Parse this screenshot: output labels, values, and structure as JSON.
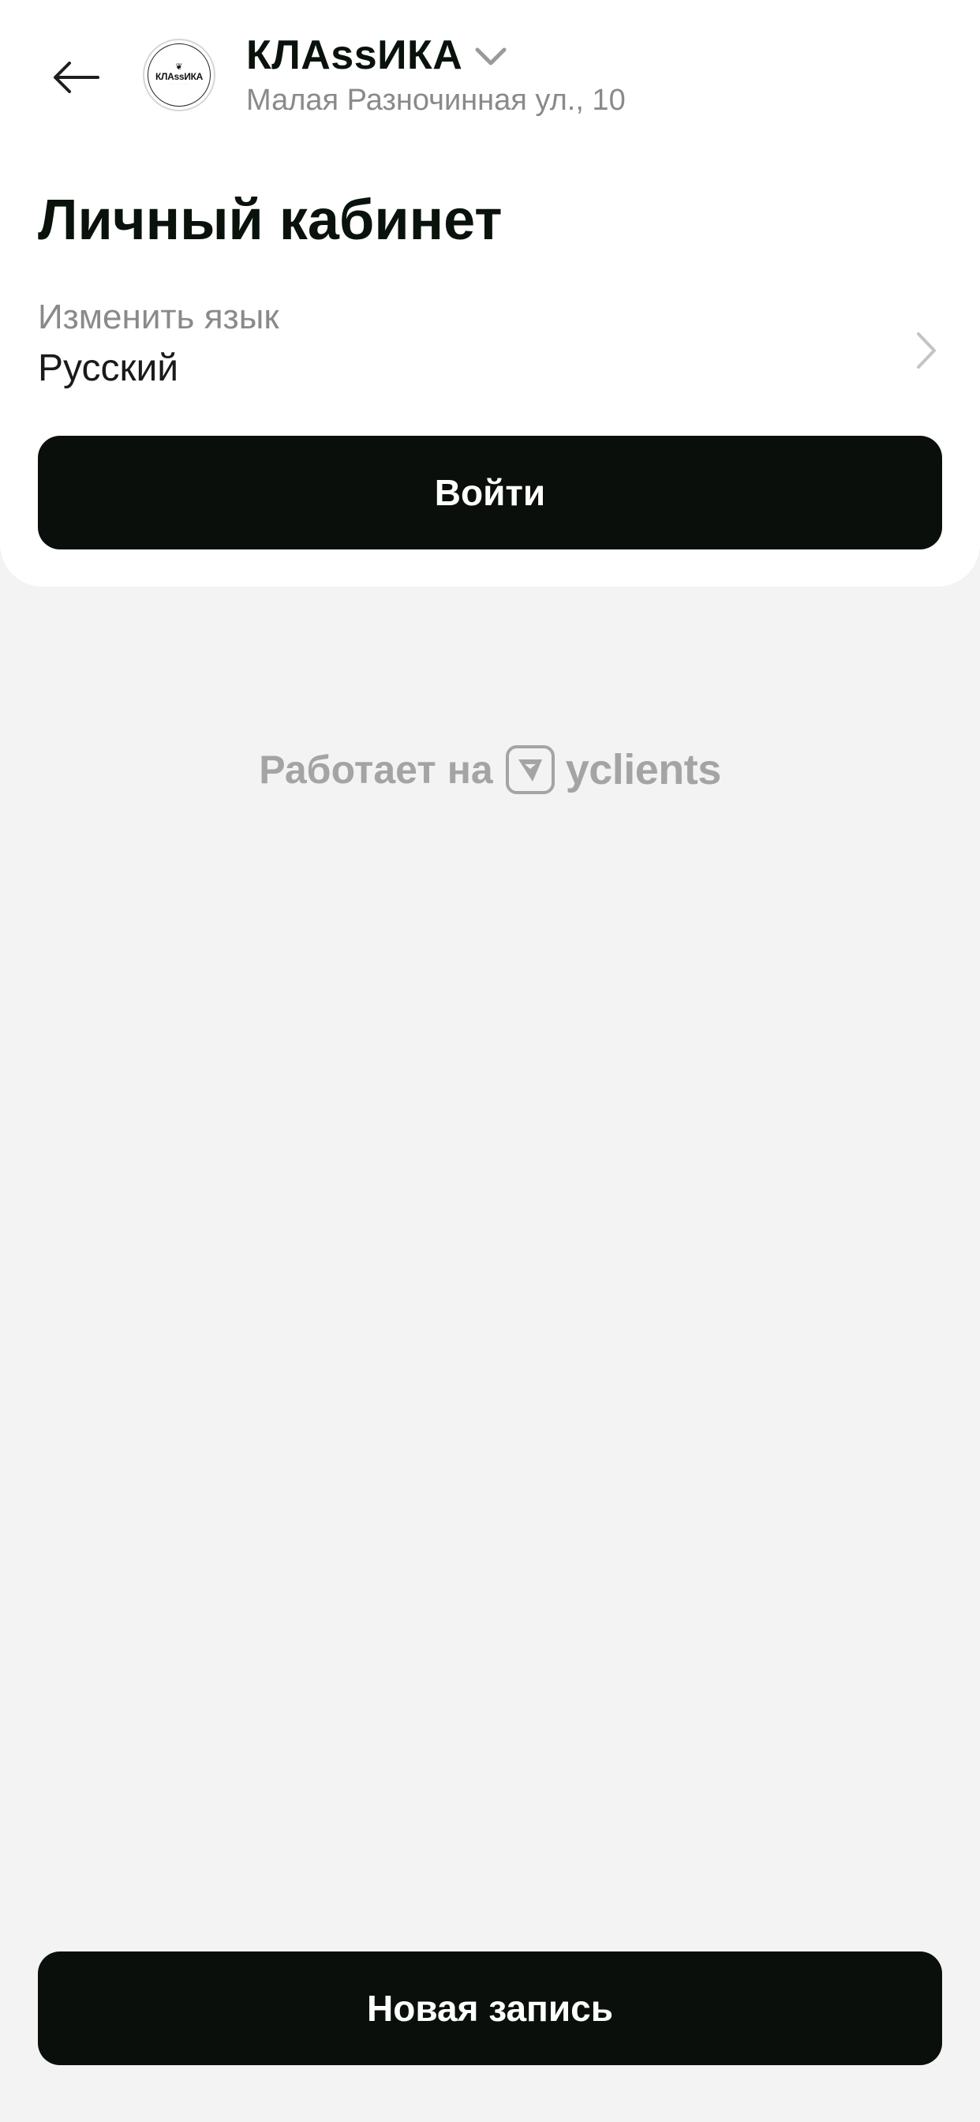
{
  "header": {
    "back_icon": "arrow-left-icon",
    "company_name": "КЛАssИКА",
    "company_address": "Малая Разночинная ул., 10",
    "avatar_logo_text": "КЛАssИКА",
    "dropdown_icon": "chevron-down-icon"
  },
  "profile": {
    "title": "Личный кабинет",
    "language_label": "Изменить язык",
    "language_value": "Русский",
    "language_icon": "chevron-right-icon",
    "login_label": "Войти"
  },
  "footer": {
    "powered_text": "Работает на",
    "powered_brand": "yclients",
    "brand_icon": "yclients-logo-icon",
    "new_record_label": "Новая запись"
  },
  "colors": {
    "background": "#f3f3f3",
    "card": "#ffffff",
    "button": "#0a0f0b",
    "muted_text": "#8a8a8a"
  }
}
